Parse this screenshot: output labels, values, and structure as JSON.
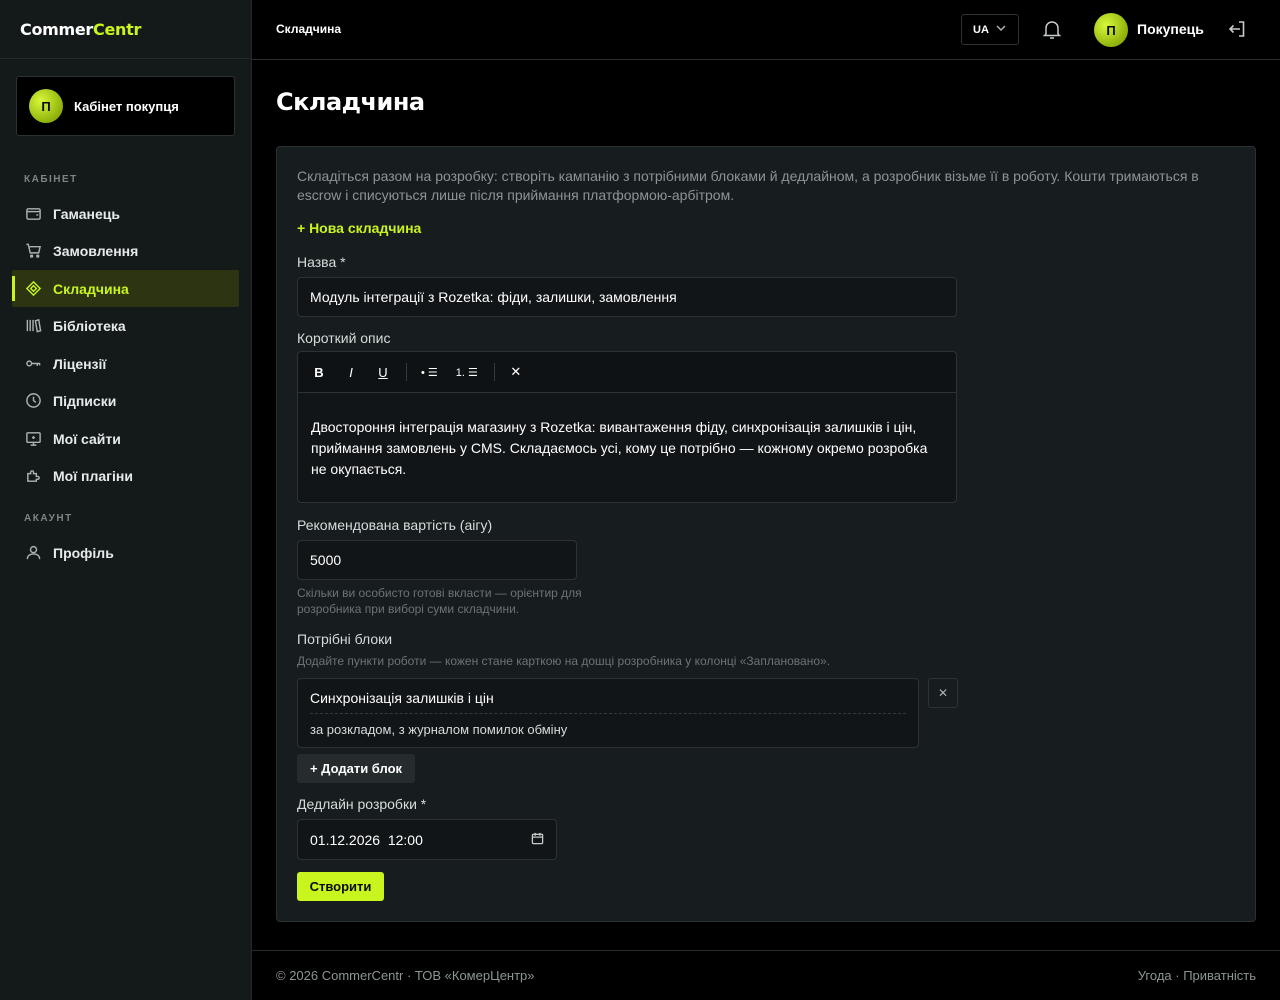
{
  "brand": {
    "part1": "Commer",
    "part2": "Centr"
  },
  "sidebar": {
    "cabinet_avatar": "П",
    "cabinet_label": "Кабінет покупця",
    "section_cabinet": "КАБІНЕТ",
    "section_account": "АКАУНТ",
    "items": [
      {
        "label": "Гаманець",
        "icon": "wallet-icon"
      },
      {
        "label": "Замовлення",
        "icon": "cart-icon"
      },
      {
        "label": "Складчина",
        "icon": "diamond-icon",
        "active": true
      },
      {
        "label": "Бібліотека",
        "icon": "library-icon"
      },
      {
        "label": "Ліцензії",
        "icon": "key-icon"
      },
      {
        "label": "Підписки",
        "icon": "clock-icon"
      },
      {
        "label": "Мої сайти",
        "icon": "monitor-icon"
      },
      {
        "label": "Мої плагіни",
        "icon": "puzzle-icon"
      }
    ],
    "account_items": [
      {
        "label": "Профіль",
        "icon": "user-icon"
      }
    ]
  },
  "topbar": {
    "breadcrumb": "Складчина",
    "lang": "UA",
    "user_avatar": "П",
    "user_name": "Покупець"
  },
  "main": {
    "title": "Складчина",
    "intro": "Складіться разом на розробку: створіть кампанію з потрібними блоками й дедлайном, а розробник візьме її в роботу. Кошти тримаються в escrow і списуються лише після приймання платформою-арбітром.",
    "new_link": "+ Нова складчина",
    "form": {
      "name_label": "Назва *",
      "name_value": "Модуль інтеграції з Rozetka: фіди, залишки, замовлення",
      "desc_label": "Короткий опис",
      "toolbar": {
        "bold": "B",
        "italic": "I",
        "underline": "U",
        "bullets": "• ☰",
        "numbers": "1. ☰",
        "clear": "✕"
      },
      "desc_value": "Двостороння інтеграція магазину з Rozetka: вивантаження фіду, синхронізація залишків і цін, приймання замовлень у CMS. Складаємось усі, кому це потрібно — кожному окремо розробка не окупається.",
      "price_label": "Рекомендована вартість (aiгу)",
      "price_value": "5000",
      "price_hint": "Скільки ви особисто готові вкласти — орієнтир для розробника при виборі суми складчини.",
      "blocks_label": "Потрібні блоки",
      "blocks_hint": "Додайте пункти роботи — кожен стане карткою на дошці розробника у колонці «Заплановано».",
      "blocks": [
        {
          "title": "Синхронізація залишків і цін",
          "desc": "за розкладом, з журналом помилок обміну"
        }
      ],
      "remove_label": "✕",
      "add_block_label": "+ Додати блок",
      "deadline_label": "Дедлайн розробки *",
      "deadline_value": "01.12.2026  12:00",
      "submit_label": "Створити"
    }
  },
  "footer": {
    "left": "© 2026 CommerCentr · ТОВ «КомерЦентр»",
    "terms": "Угода",
    "separator": " · ",
    "privacy": "Приватність"
  },
  "colors": {
    "accent": "#c8f51e",
    "sidebar_bg": "#141a1a",
    "panel_bg": "#171c1e"
  }
}
